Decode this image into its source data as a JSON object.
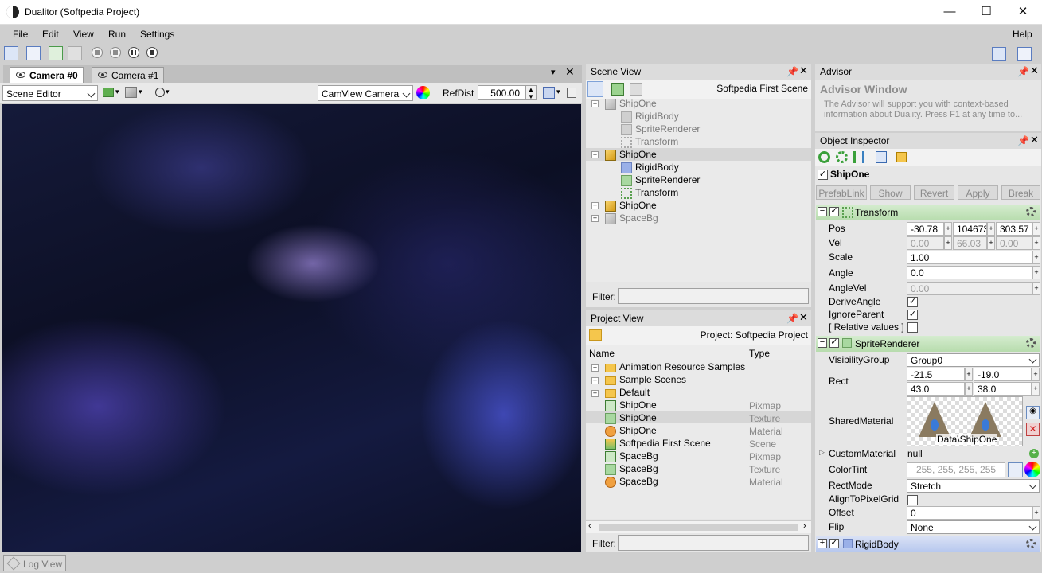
{
  "window": {
    "title": "Dualitor (Softpedia Project)",
    "minimize": "—",
    "maximize": "☐",
    "close": "✕"
  },
  "menu": {
    "file": "File",
    "edit": "Edit",
    "view": "View",
    "run": "Run",
    "settings": "Settings",
    "help": "Help"
  },
  "camera_tabs": [
    {
      "label": "Camera #0"
    },
    {
      "label": "Camera #1"
    }
  ],
  "camera_toolbar": {
    "mode": "Scene Editor",
    "camera": "CamView Camera",
    "refdist_label": "RefDist",
    "refdist_value": "500.00"
  },
  "scene_view": {
    "title": "Scene View",
    "scene_name": "Softpedia First Scene",
    "tree": [
      {
        "label": "ShipOne",
        "icon": "object-cube-icon",
        "dim": true
      },
      {
        "label": "RigidBody",
        "icon": "rigidbody-icon",
        "dim": true
      },
      {
        "label": "SpriteRenderer",
        "icon": "spriterenderer-icon",
        "dim": true
      },
      {
        "label": "Transform",
        "icon": "transform-icon",
        "dim": true
      },
      {
        "label": "ShipOne",
        "icon": "object-cube-icon",
        "dim": false
      },
      {
        "label": "RigidBody",
        "icon": "rigidbody-icon",
        "dim": false
      },
      {
        "label": "SpriteRenderer",
        "icon": "spriterenderer-icon",
        "dim": false
      },
      {
        "label": "Transform",
        "icon": "transform-icon",
        "dim": false
      },
      {
        "label": "ShipOne",
        "icon": "object-cube-icon",
        "dim": false
      },
      {
        "label": "SpaceBg",
        "icon": "object-cube-icon",
        "dim": true
      }
    ],
    "filter_label": "Filter:"
  },
  "project_view": {
    "title": "Project View",
    "project_label": "Project: Softpedia Project",
    "col_name": "Name",
    "col_type": "Type",
    "items": [
      {
        "name": "Animation Resource Samples",
        "type": "",
        "icon": "folder-icon"
      },
      {
        "name": "Sample Scenes",
        "type": "",
        "icon": "folder-icon"
      },
      {
        "name": "Default",
        "type": "",
        "icon": "folder-icon"
      },
      {
        "name": "ShipOne",
        "type": "Pixmap",
        "icon": "pixmap-icon"
      },
      {
        "name": "ShipOne",
        "type": "Texture",
        "icon": "texture-icon"
      },
      {
        "name": "ShipOne",
        "type": "Material",
        "icon": "material-icon"
      },
      {
        "name": "Softpedia First Scene",
        "type": "Scene",
        "icon": "scene-icon"
      },
      {
        "name": "SpaceBg",
        "type": "Pixmap",
        "icon": "pixmap-icon"
      },
      {
        "name": "SpaceBg",
        "type": "Texture",
        "icon": "texture-icon"
      },
      {
        "name": "SpaceBg",
        "type": "Material",
        "icon": "material-icon"
      }
    ],
    "filter_label": "Filter:"
  },
  "advisor": {
    "title": "Advisor",
    "heading": "Advisor Window",
    "text_line1": "The Advisor will support you with context-based",
    "text_line2": "information about Duality. Press F1 at any time to..."
  },
  "inspector": {
    "title": "Object Inspector",
    "object_name": "ShipOne",
    "buttons": {
      "prefablink": "PrefabLink",
      "show": "Show",
      "revert": "Revert",
      "apply": "Apply",
      "break": "Break"
    },
    "transform": {
      "header": "Transform",
      "pos_label": "Pos",
      "pos": [
        "-30.78",
        "104673.",
        "303.57"
      ],
      "vel_label": "Vel",
      "vel": [
        "0.00",
        "66.03",
        "0.00"
      ],
      "scale_label": "Scale",
      "scale": "1.00",
      "angle_label": "Angle",
      "angle": "0.0",
      "anglevel_label": "AngleVel",
      "anglevel": "0.00",
      "deriveangle_label": "DeriveAngle",
      "ignoreparent_label": "IgnoreParent",
      "relative_label": "[ Relative values ]"
    },
    "sprite": {
      "header": "SpriteRenderer",
      "visgroup_label": "VisibilityGroup",
      "visgroup": "Group0",
      "rect_label": "Rect",
      "rect": [
        "-21.5",
        "-19.0",
        "43.0",
        "38.0"
      ],
      "material_label": "SharedMaterial",
      "material": "Data\\ShipOne",
      "custommat_label": "CustomMaterial",
      "custommat": "null",
      "colortint_label": "ColorTint",
      "colortint": "255, 255, 255, 255",
      "rectmode_label": "RectMode",
      "rectmode": "Stretch",
      "align_label": "AlignToPixelGrid",
      "offset_label": "Offset",
      "offset": "0",
      "flip_label": "Flip",
      "flip": "None"
    },
    "rigidbody": {
      "header": "RigidBody"
    }
  },
  "status": {
    "log_view": "Log View"
  }
}
